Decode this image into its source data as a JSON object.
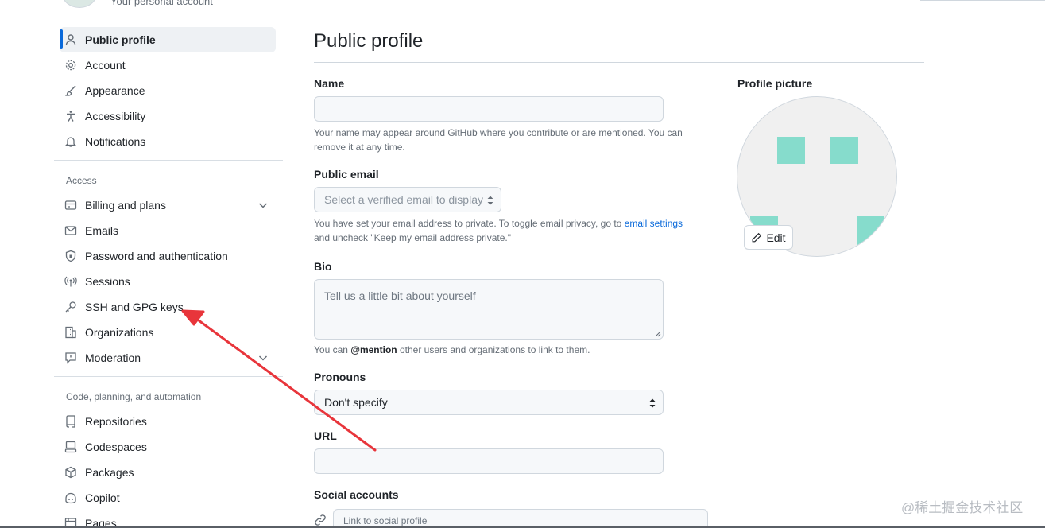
{
  "header": {
    "subtitle": "Your personal account"
  },
  "sidebar": {
    "items": [
      {
        "label": "Public profile",
        "icon": "person-icon",
        "active": true
      },
      {
        "label": "Account",
        "icon": "gear-icon"
      },
      {
        "label": "Appearance",
        "icon": "paintbrush-icon"
      },
      {
        "label": "Accessibility",
        "icon": "accessibility-icon"
      },
      {
        "label": "Notifications",
        "icon": "bell-icon"
      }
    ],
    "access_title": "Access",
    "access_items": [
      {
        "label": "Billing and plans",
        "icon": "credit-card-icon",
        "expandable": true
      },
      {
        "label": "Emails",
        "icon": "mail-icon"
      },
      {
        "label": "Password and authentication",
        "icon": "shield-lock-icon"
      },
      {
        "label": "Sessions",
        "icon": "broadcast-icon"
      },
      {
        "label": "SSH and GPG keys",
        "icon": "key-icon"
      },
      {
        "label": "Organizations",
        "icon": "organization-icon"
      },
      {
        "label": "Moderation",
        "icon": "report-icon",
        "expandable": true
      }
    ],
    "code_title": "Code, planning, and automation",
    "code_items": [
      {
        "label": "Repositories",
        "icon": "repo-icon"
      },
      {
        "label": "Codespaces",
        "icon": "codespaces-icon"
      },
      {
        "label": "Packages",
        "icon": "package-icon"
      },
      {
        "label": "Copilot",
        "icon": "copilot-icon"
      },
      {
        "label": "Pages",
        "icon": "browser-icon"
      }
    ]
  },
  "main": {
    "title": "Public profile",
    "name": {
      "label": "Name",
      "value": "",
      "note": "Your name may appear around GitHub where you contribute or are mentioned. You can remove it at any time."
    },
    "public_email": {
      "label": "Public email",
      "selected": "Select a verified email to display",
      "note_before": "You have set your email address to private. To toggle email privacy, go to ",
      "note_link": "email settings",
      "note_after": " and uncheck \"Keep my email address private.\""
    },
    "bio": {
      "label": "Bio",
      "placeholder": "Tell us a little bit about yourself",
      "note_before": "You can ",
      "note_mention": "@mention",
      "note_after": " other users and organizations to link to them."
    },
    "pronouns": {
      "label": "Pronouns",
      "selected": "Don't specify"
    },
    "url": {
      "label": "URL",
      "value": ""
    },
    "social": {
      "label": "Social accounts",
      "placeholder": "Link to social profile"
    }
  },
  "profile_picture": {
    "label": "Profile picture",
    "edit_label": "Edit",
    "identicon_color": "#86dccc"
  },
  "annotation": {
    "arrow_color": "#e8353b"
  },
  "watermark": "@稀土掘金技术社区"
}
